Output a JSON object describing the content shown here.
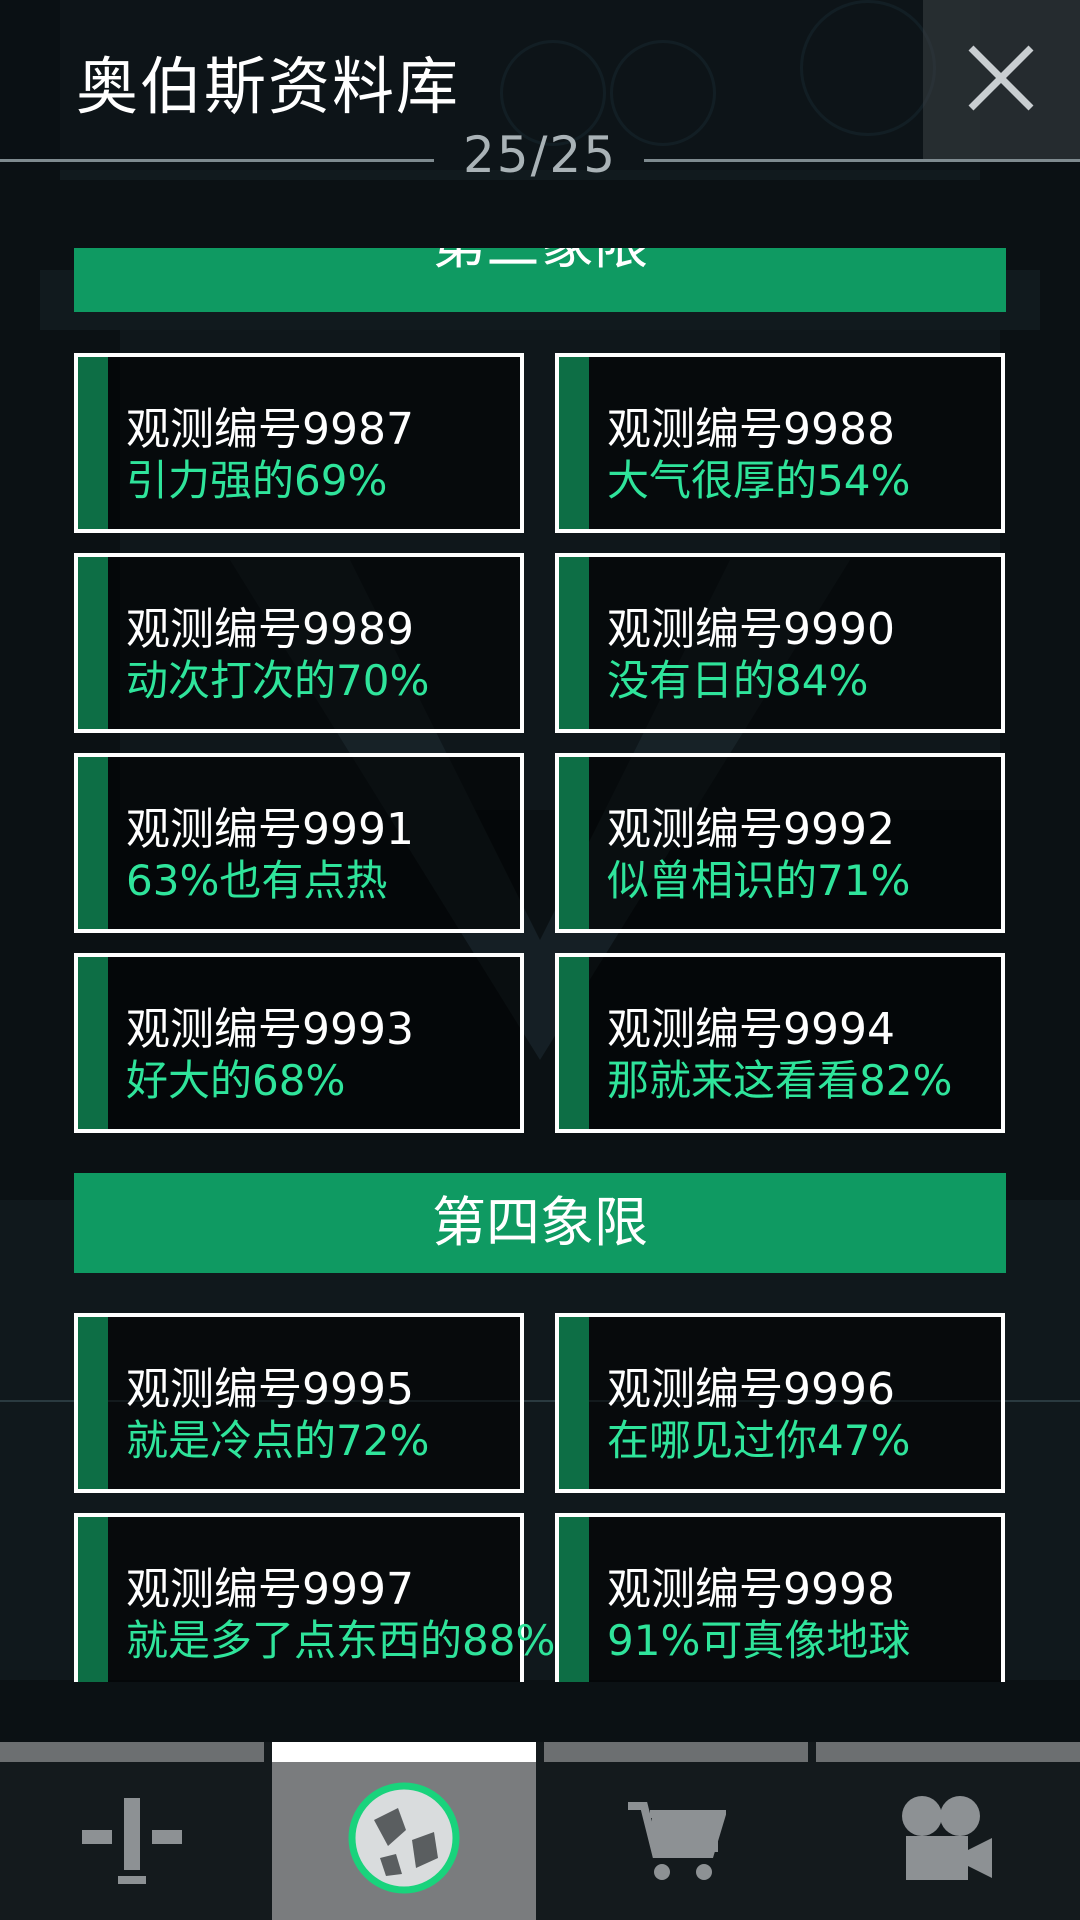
{
  "header": {
    "title": "奥伯斯资料库",
    "counter": "25/25",
    "close_icon": "close-icon"
  },
  "sections": [
    {
      "title": "第三象限",
      "cards": [
        {
          "code": "观测编号9987",
          "desc": "引力强的69%"
        },
        {
          "code": "观测编号9988",
          "desc": "大气很厚的54%"
        },
        {
          "code": "观测编号9989",
          "desc": "动次打次的70%"
        },
        {
          "code": "观测编号9990",
          "desc": "没有日的84%"
        },
        {
          "code": "观测编号9991",
          "desc": "63%也有点热"
        },
        {
          "code": "观测编号9992",
          "desc": "似曾相识的71%"
        },
        {
          "code": "观测编号9993",
          "desc": "好大的68%"
        },
        {
          "code": "观测编号9994",
          "desc": "那就来这看看82%"
        }
      ]
    },
    {
      "title": "第四象限",
      "cards": [
        {
          "code": "观测编号9995",
          "desc": "就是冷点的72%"
        },
        {
          "code": "观测编号9996",
          "desc": "在哪见过你47%"
        },
        {
          "code": "观测编号9997",
          "desc": "就是多了点东西的88%"
        },
        {
          "code": "观测编号9998",
          "desc": "91%可真像地球"
        }
      ]
    }
  ],
  "nav": {
    "active_index": 1,
    "tabs": [
      {
        "icon": "tool-icon"
      },
      {
        "icon": "planet-icon"
      },
      {
        "icon": "cart-icon"
      },
      {
        "icon": "video-camera-icon"
      }
    ]
  },
  "colors": {
    "accent_green": "#0f9a62",
    "desc_green": "#2fe49b",
    "card_bar": "#0d6e45"
  }
}
